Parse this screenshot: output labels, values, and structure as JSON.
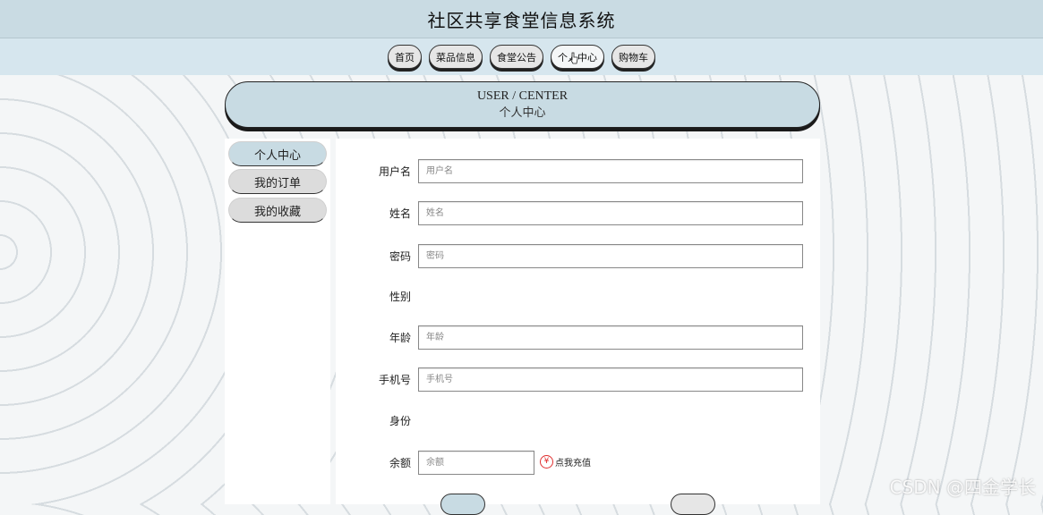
{
  "app": {
    "title": "社区共享食堂信息系统"
  },
  "nav": {
    "items": [
      {
        "label": "首页"
      },
      {
        "label": "菜品信息"
      },
      {
        "label": "食堂公告"
      },
      {
        "label": "个人中心"
      },
      {
        "label": "购物车"
      }
    ],
    "active": "个人中心"
  },
  "header": {
    "en": "USER / CENTER",
    "cn": "个人中心"
  },
  "sidebar": {
    "items": [
      {
        "label": "个人中心"
      },
      {
        "label": "我的订单"
      },
      {
        "label": "我的收藏"
      }
    ]
  },
  "form": {
    "username": {
      "label": "用户名",
      "placeholder": "用户名"
    },
    "name": {
      "label": "姓名",
      "placeholder": "姓名"
    },
    "password": {
      "label": "密码",
      "placeholder": "密码"
    },
    "gender": {
      "label": "性别"
    },
    "age": {
      "label": "年龄",
      "placeholder": "年龄"
    },
    "phone": {
      "label": "手机号",
      "placeholder": "手机号"
    },
    "identity": {
      "label": "身份"
    },
    "balance": {
      "label": "余额",
      "placeholder": "余额"
    },
    "recharge": {
      "icon": "¥",
      "label": "点我充值"
    }
  },
  "watermark": "CSDN @四金学长",
  "colors": {
    "accent": "#c8dbe3",
    "nav_bg": "#d6e6ee",
    "recharge_icon": "#e03030"
  }
}
